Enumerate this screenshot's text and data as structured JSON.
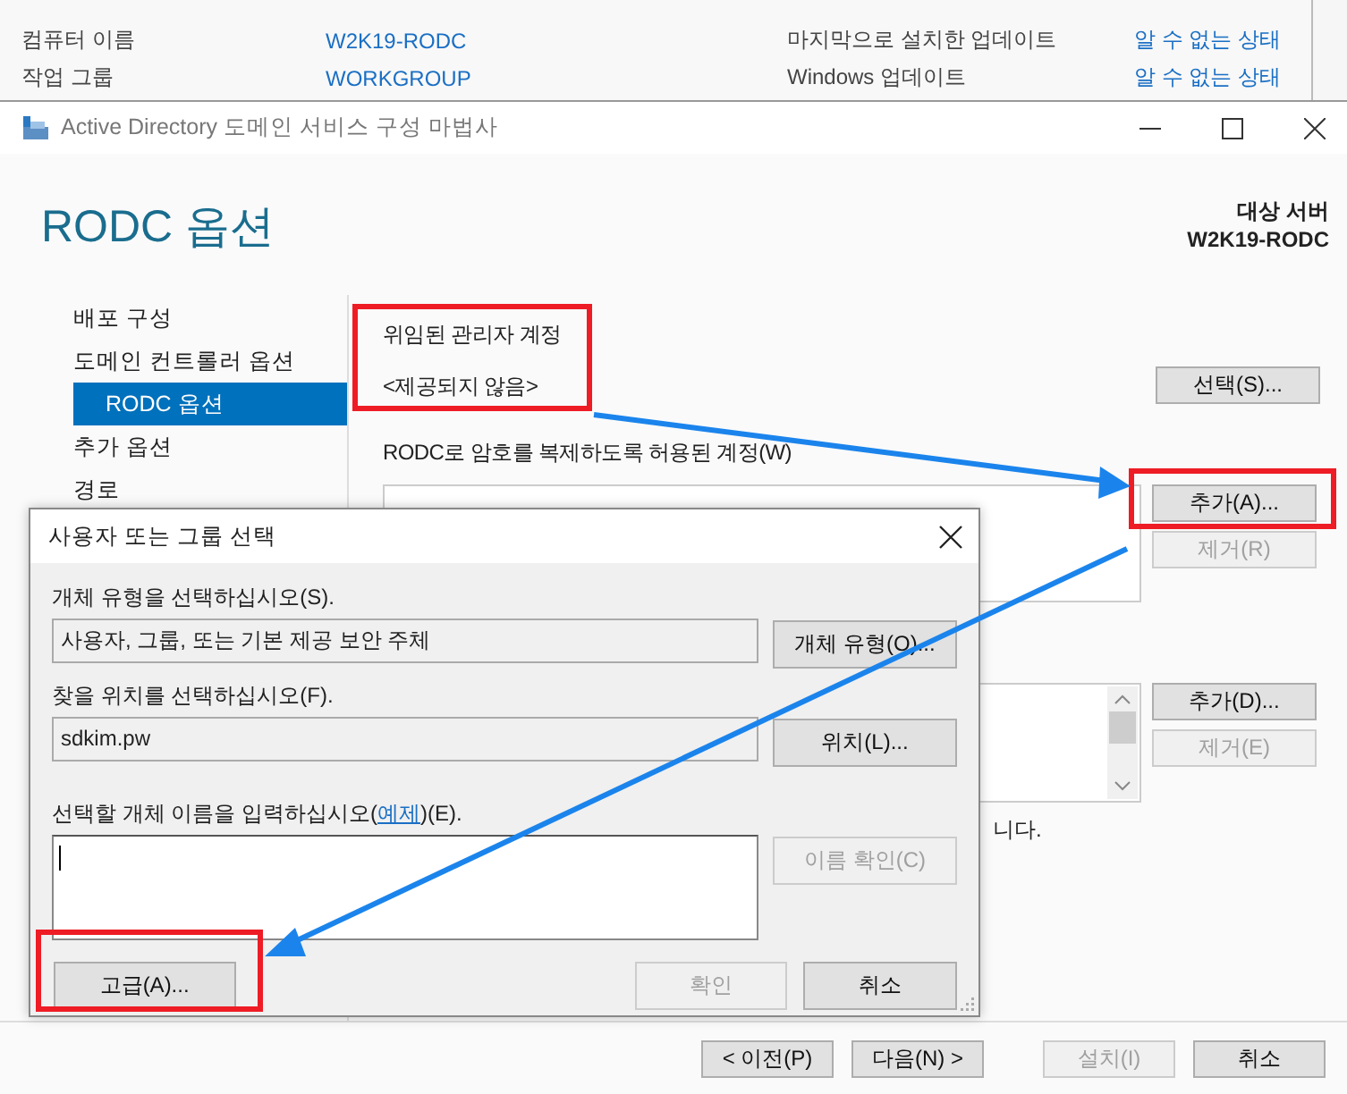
{
  "server_panel": {
    "rows": [
      {
        "label": "컴퓨터 이름",
        "value": "W2K19-RODC",
        "label_2": "마지막으로 설치한 업데이트",
        "value_2": "알 수 없는 상태"
      },
      {
        "label": "작업 그룹",
        "value": "WORKGROUP",
        "label_2": "Windows 업데이트",
        "value_2": "알 수 없는 상태"
      }
    ]
  },
  "wizard": {
    "title": "Active Directory 도메인 서비스 구성 마법사",
    "heading": "RODC 옵션",
    "target_label": "대상 서버",
    "target_server": "W2K19-RODC",
    "nav": [
      {
        "label": "배포 구성",
        "selected": false
      },
      {
        "label": "도메인 컨트롤러 옵션",
        "selected": false,
        "children": [
          {
            "label": "RODC 옵션",
            "selected": true
          }
        ]
      },
      {
        "label": "추가 옵션",
        "selected": false
      },
      {
        "label": "경로",
        "selected": false
      }
    ],
    "delegated_admin": {
      "label": "위임된 관리자 계정",
      "value": "<제공되지 않음>",
      "button": {
        "label": "선택(S)...",
        "disabled": false
      }
    },
    "allowed_accounts": {
      "label": "RODC로 암호를 복제하도록 허용된 계정(W)",
      "buttons": [
        {
          "label": "추가(A)...",
          "disabled": false
        },
        {
          "label": "제거(R)",
          "disabled": true
        }
      ]
    },
    "denied_accounts": {
      "buttons": [
        {
          "label": "추가(D)...",
          "disabled": false
        },
        {
          "label": "제거(E)",
          "disabled": true
        }
      ]
    },
    "note_fragment": "니다.",
    "footer_buttons": [
      {
        "label": "< 이전(P)",
        "disabled": false
      },
      {
        "label": "다음(N) >",
        "disabled": false
      },
      {
        "label": "설치(I)",
        "disabled": true
      },
      {
        "label": "취소",
        "disabled": false
      }
    ]
  },
  "dialog": {
    "title": "사용자 또는 그룹 선택",
    "object_type": {
      "label": "개체 유형을 선택하십시오(S).",
      "value": "사용자, 그룹, 또는 기본 제공 보안 주체",
      "button": {
        "label": "개체 유형(O)...",
        "disabled": false
      }
    },
    "location": {
      "label": "찾을 위치를 선택하십시오(F).",
      "value": "sdkim.pw",
      "button": {
        "label": "위치(L)...",
        "disabled": false
      }
    },
    "names": {
      "label_before": "선택할 개체 이름을 입력하십시오(",
      "link": "예제",
      "label_after": ")(E).",
      "button": {
        "label": "이름 확인(C)",
        "disabled": true
      }
    },
    "buttons": [
      {
        "label": "고급(A)...",
        "disabled": false
      },
      {
        "label": "확인",
        "disabled": true
      },
      {
        "label": "취소",
        "disabled": false
      }
    ]
  }
}
